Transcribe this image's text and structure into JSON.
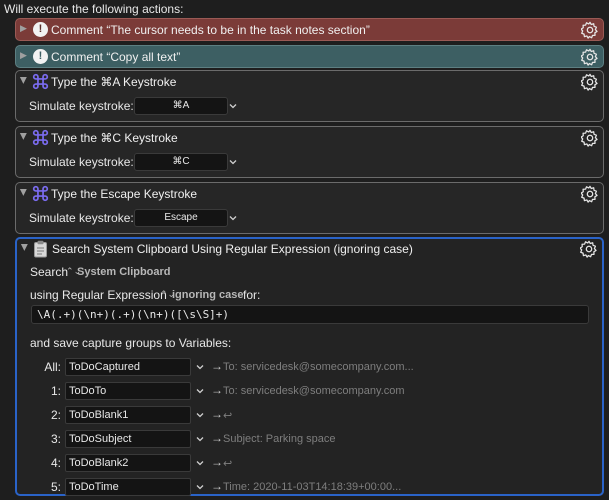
{
  "header": {
    "text": "Will execute the following actions:"
  },
  "actions": {
    "comment1": {
      "title": "Comment “The cursor needs to be in the task notes section”"
    },
    "comment2": {
      "title": "Comment “Copy all text”"
    },
    "type1": {
      "title": "Type the ⌘A Keystroke",
      "label": "Simulate keystroke:",
      "key": "⌘A"
    },
    "type2": {
      "title": "Type the ⌘C Keystroke",
      "label": "Simulate keystroke:",
      "key": "⌘C"
    },
    "type3": {
      "title": "Type the Escape Keystroke",
      "label": "Simulate keystroke:",
      "key": "Escape"
    },
    "search": {
      "title": "Search System Clipboard Using Regular Expression (ignoring case)",
      "search_label": "Search",
      "source": "System Clipboard",
      "using_label": "using Regular Expression",
      "case_mode": "ignoring case",
      "for_label": "for:",
      "regex": "\\A(.+)(\\n+)(.+)(\\n+)([\\s\\S]+)",
      "save_label": "and save capture groups to Variables:",
      "variables": [
        {
          "label": "All:",
          "name": "ToDoCaptured",
          "preview": "To: servicedesk@somecompany.com..."
        },
        {
          "label": "1:",
          "name": "ToDoTo",
          "preview": "To: servicedesk@somecompany.com"
        },
        {
          "label": "2:",
          "name": "ToDoBlank1",
          "preview": "↩"
        },
        {
          "label": "3:",
          "name": "ToDoSubject",
          "preview": "Subject: Parking space"
        },
        {
          "label": "4:",
          "name": "ToDoBlank2",
          "preview": "↩"
        },
        {
          "label": "5:",
          "name": "ToDoTime",
          "preview": "Time: 2020-11-03T14:18:39+00:00..."
        }
      ]
    }
  },
  "colors": {
    "comment_red": "#7b3b38",
    "comment_teal": "#3d5f63",
    "selection_blue": "#2a63c8",
    "cmd_icon": "#7b6cf0"
  },
  "icons": {
    "disclosure": "disclosure-triangle-icon",
    "gear": "gear-icon",
    "comment": "exclamation-icon",
    "keystroke": "command-key-icon",
    "clipboard": "clipboard-icon"
  }
}
